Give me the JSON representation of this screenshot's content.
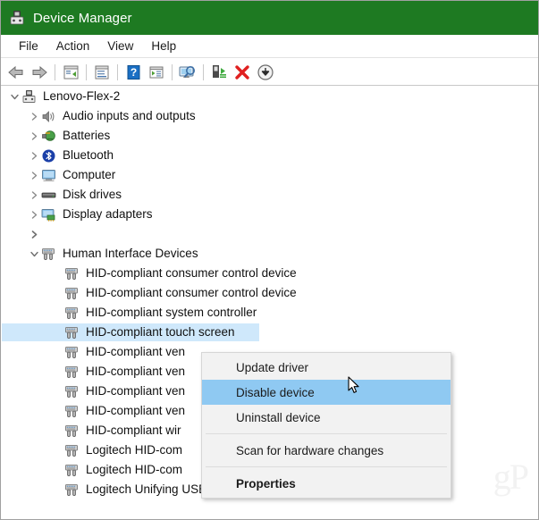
{
  "window": {
    "title": "Device Manager",
    "icon": "device-manager-icon",
    "titlebar_color": "#1e7a22"
  },
  "menubar": {
    "items": [
      {
        "label": "File",
        "name": "menu-file"
      },
      {
        "label": "Action",
        "name": "menu-action"
      },
      {
        "label": "View",
        "name": "menu-view"
      },
      {
        "label": "Help",
        "name": "menu-help"
      }
    ]
  },
  "toolbar": {
    "buttons": [
      {
        "icon": "back-arrow-icon",
        "name": "toolbar-back"
      },
      {
        "icon": "forward-arrow-icon",
        "name": "toolbar-forward"
      },
      {
        "separator": true
      },
      {
        "icon": "properties-window-icon",
        "name": "toolbar-properties"
      },
      {
        "separator": true
      },
      {
        "icon": "list-view-icon",
        "name": "toolbar-list-view"
      },
      {
        "separator": true
      },
      {
        "icon": "help-question-icon",
        "name": "toolbar-help"
      },
      {
        "icon": "play-list-icon",
        "name": "toolbar-scan"
      },
      {
        "separator": true
      },
      {
        "icon": "scan-monitor-icon",
        "name": "toolbar-scan-hardware"
      },
      {
        "separator": true
      },
      {
        "icon": "update-driver-icon",
        "name": "toolbar-update-driver"
      },
      {
        "icon": "uninstall-red-x-icon",
        "name": "toolbar-uninstall"
      },
      {
        "icon": "disable-device-icon",
        "name": "toolbar-disable"
      }
    ]
  },
  "tree": {
    "root": {
      "label": "Lenovo-Flex-2",
      "icon": "computer-root-icon",
      "expanded": true
    },
    "nodes": [
      {
        "label": "Audio inputs and outputs",
        "icon": "speaker-icon",
        "level": 1,
        "expanded": false,
        "has_chevron": true
      },
      {
        "label": "Batteries",
        "icon": "battery-icon",
        "level": 1,
        "expanded": false,
        "has_chevron": true
      },
      {
        "label": "Bluetooth",
        "icon": "bluetooth-icon",
        "level": 1,
        "expanded": false,
        "has_chevron": true
      },
      {
        "label": "Computer",
        "icon": "monitor-icon",
        "level": 1,
        "expanded": false,
        "has_chevron": true
      },
      {
        "label": "Disk drives",
        "icon": "disk-drive-icon",
        "level": 1,
        "expanded": false,
        "has_chevron": true
      },
      {
        "label": "Display adapters",
        "icon": "display-adapter-icon",
        "level": 1,
        "expanded": false,
        "has_chevron": true
      },
      {
        "label": "",
        "icon": "",
        "level": 1,
        "expanded": false,
        "has_chevron": true
      },
      {
        "label": "Human Interface Devices",
        "icon": "hid-icon",
        "level": 1,
        "expanded": true,
        "has_chevron": true
      },
      {
        "label": "HID-compliant consumer control device",
        "icon": "hid-icon",
        "level": 2,
        "has_chevron": false
      },
      {
        "label": "HID-compliant consumer control device",
        "icon": "hid-icon",
        "level": 2,
        "has_chevron": false
      },
      {
        "label": "HID-compliant system controller",
        "icon": "hid-icon",
        "level": 2,
        "has_chevron": false
      },
      {
        "label": "HID-compliant touch screen",
        "icon": "hid-icon",
        "level": 2,
        "has_chevron": false,
        "selected": true
      },
      {
        "label": "HID-compliant ven",
        "icon": "hid-icon",
        "level": 2,
        "has_chevron": false
      },
      {
        "label": "HID-compliant ven",
        "icon": "hid-icon",
        "level": 2,
        "has_chevron": false
      },
      {
        "label": "HID-compliant ven",
        "icon": "hid-icon",
        "level": 2,
        "has_chevron": false
      },
      {
        "label": "HID-compliant ven",
        "icon": "hid-icon",
        "level": 2,
        "has_chevron": false
      },
      {
        "label": "HID-compliant wir",
        "icon": "hid-icon",
        "level": 2,
        "has_chevron": false
      },
      {
        "label": "Logitech HID-com",
        "icon": "hid-icon",
        "level": 2,
        "has_chevron": false
      },
      {
        "label": "Logitech HID-com",
        "icon": "hid-icon",
        "level": 2,
        "has_chevron": false
      },
      {
        "label": "Logitech Unifying USB receiver",
        "icon": "hid-icon",
        "level": 2,
        "has_chevron": false
      }
    ]
  },
  "context_menu": {
    "items": [
      {
        "label": "Update driver",
        "name": "ctx-update-driver",
        "highlight": false,
        "bold": false
      },
      {
        "label": "Disable device",
        "name": "ctx-disable-device",
        "highlight": true,
        "bold": false
      },
      {
        "label": "Uninstall device",
        "name": "ctx-uninstall-device",
        "highlight": false,
        "bold": false
      },
      {
        "separator": true
      },
      {
        "label": "Scan for hardware changes",
        "name": "ctx-scan-hardware-changes",
        "highlight": false,
        "bold": false
      },
      {
        "separator": true
      },
      {
        "label": "Properties",
        "name": "ctx-properties",
        "highlight": false,
        "bold": true
      }
    ],
    "highlight_color": "#8fc9f2"
  },
  "watermark": {
    "text": "gP"
  }
}
